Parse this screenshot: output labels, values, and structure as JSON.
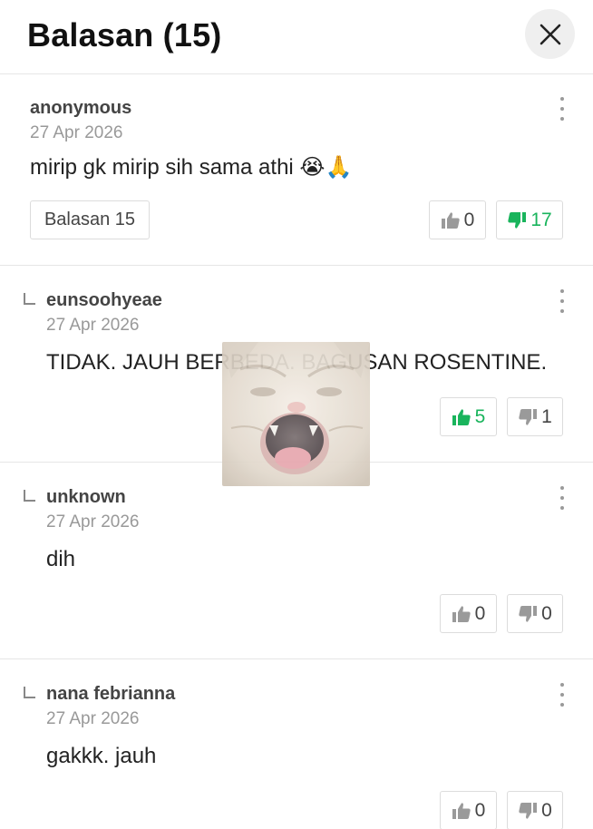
{
  "header": {
    "title": "Balasan (15)"
  },
  "comments": [
    {
      "username": "anonymous",
      "date": "27 Apr 2026",
      "text": "mirip gk mirip sih sama athi 😭🙏",
      "reply_button": "Balasan 15",
      "likes": "0",
      "dislikes": "17"
    },
    {
      "username": "eunsoohyeae",
      "date": "27 Apr 2026",
      "text": "TIDAK. JAUH BERBEDA. BAGUSAN ROSENTINE.",
      "likes": "5",
      "dislikes": "1"
    },
    {
      "username": "unknown",
      "date": "27 Apr 2026",
      "text": "dih",
      "likes": "0",
      "dislikes": "0"
    },
    {
      "username": "nana febrianna",
      "date": "27 Apr 2026",
      "text": "gakkk. jauh",
      "likes": "0",
      "dislikes": "0"
    }
  ],
  "icons": {
    "close": "close-icon",
    "more": "more-vertical-icon",
    "like": "thumbs-up-icon",
    "dislike": "thumbs-down-icon",
    "reply_indicator": "reply-corner-icon"
  },
  "colors": {
    "active_vote": "#19b45c",
    "inactive_vote": "#9a9a9a",
    "divider": "#e6e6e6"
  }
}
